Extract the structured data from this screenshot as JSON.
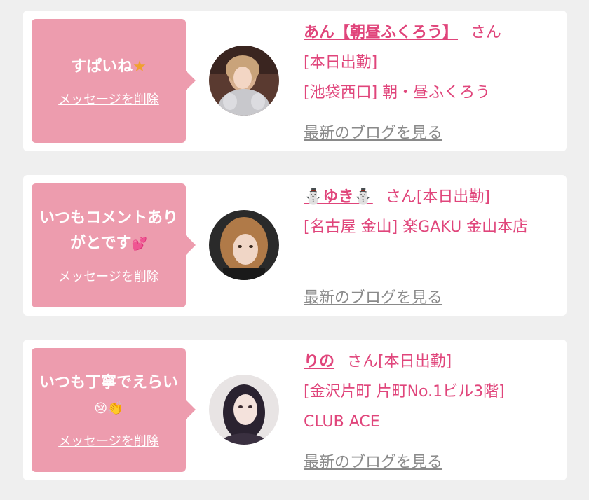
{
  "messages": [
    {
      "message": "すぱいね",
      "emoji": "★",
      "delete_label": "メッセージを削除",
      "name": "あん【朝昼ふくろう】",
      "san": "さん",
      "status": "[本日出勤]",
      "location": "[池袋西口] 朝・昼ふくろう",
      "blog_label": "最新のブログを見る"
    },
    {
      "message": "いつもコメントありがとです",
      "emoji": "💕",
      "delete_label": "メッセージを削除",
      "name": "⛄ゆき⛄",
      "san": "さん",
      "status": "[本日出勤]",
      "location": "[名古屋 金山] 楽GAKU 金山本店",
      "blog_label": "最新のブログを見る"
    },
    {
      "message": "いつも丁寧でえらい",
      "emoji": "😢👏",
      "delete_label": "メッセージを削除",
      "name": "りの",
      "san": "さん",
      "status": "[本日出勤]",
      "location": "[金沢片町 片町No.1ビル3階] CLUB ACE",
      "blog_label": "最新のブログを見る"
    }
  ],
  "colors": {
    "bubble": "#ed9cae",
    "accent": "#e0457b",
    "link_gray": "#8a8a8a",
    "background": "#efefef"
  }
}
